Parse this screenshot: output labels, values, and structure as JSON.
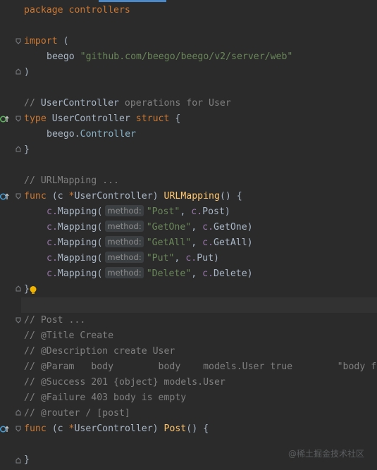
{
  "lines": {
    "l1_kw": "package",
    "l1_name": " controllers",
    "l3_kw": "import",
    "l3_rest": " (",
    "l4_alias": "beego",
    "l4_path": "\"github.com/beego/beego/v2/server/web\"",
    "l5": ")",
    "l7_a": "// ",
    "l7_b": "UserController",
    "l7_c": " operations for User",
    "l8_kw1": "type",
    "l8_name": " UserController",
    "l8_kw2": " struct",
    "l8_rest": " {",
    "l9_pkg": "beego.",
    "l9_type": "Controller",
    "l10": "}",
    "l12": "// URLMapping ...",
    "l13_kw": "func",
    "l13_a": " (c ",
    "l13_star": "*",
    "l13_recvtype": "UserController",
    "l13_b": ") ",
    "l13_fn": "URLMapping",
    "l13_c": "() {",
    "hint_label": "method:",
    "mapping": [
      {
        "str": "\"Post\"",
        "target": "Post"
      },
      {
        "str": "\"GetOne\"",
        "target": "GetOne"
      },
      {
        "str": "\"GetAll\"",
        "target": "GetAll"
      },
      {
        "str": "\"Put\"",
        "target": "Put"
      },
      {
        "str": "\"Delete\"",
        "target": "Delete"
      }
    ],
    "mapping_prefix": "c.",
    "mapping_call": "Mapping(",
    "l19": "}",
    "c1": "// Post ...",
    "c2": "// @Title Create",
    "c3": "// @Description create User",
    "c4": "// @Param   body        body    models.User true        \"body f",
    "c5": "// @Success 201 {object} models.User",
    "c6": "// @Failure 403 body is empty",
    "c7": "// @router / [post]",
    "l29_kw": "func",
    "l29_a": " (c ",
    "l29_star": "*",
    "l29_recvtype": "UserController",
    "l29_b": ") ",
    "l29_fn": "Post",
    "l29_c": "() {",
    "l31": "}"
  },
  "watermark": "@稀土掘金技术社区",
  "colors": {
    "background": "#2b2b2b",
    "keyword": "#cc7832",
    "string": "#6a8759",
    "function": "#ffc66d",
    "field": "#9876aa",
    "comment": "#808080",
    "text": "#a9b7c6"
  }
}
